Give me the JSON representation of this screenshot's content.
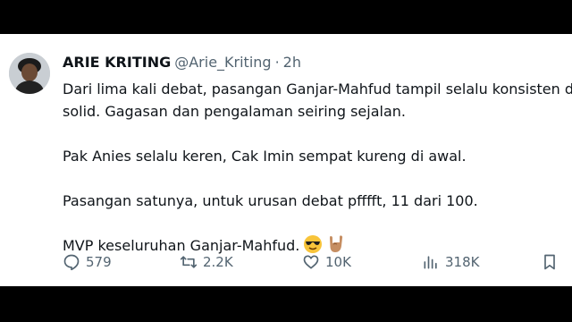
{
  "tweet": {
    "display_name": "ARIE KRITING",
    "handle": "@Arie_Kriting",
    "separator": "·",
    "time": "2h",
    "lines": [
      "Dari lima kali debat, pasangan Ganjar-Mahfud tampil selalu konsisten dan",
      "solid. Gagasan dan pengalaman seiring sejalan.",
      "Pak Anies selalu keren, Cak Imin sempat kureng di awal.",
      "Pasangan satunya, untuk urusan debat pfffft, 11 dari 100.",
      "MVP keseluruhan Ganjar-Mahfud."
    ],
    "emojis": [
      "smiling-face-with-sunglasses",
      "sign-of-the-horns"
    ]
  },
  "actions": {
    "reply_count": "579",
    "retweet_count": "2.2K",
    "like_count": "10K",
    "view_count": "318K",
    "icons": [
      "reply-icon",
      "retweet-icon",
      "like-icon",
      "views-icon",
      "bookmark-icon"
    ]
  },
  "colors": {
    "background": "#000000",
    "card": "#ffffff",
    "text": "#0f1419",
    "muted": "#536471"
  }
}
